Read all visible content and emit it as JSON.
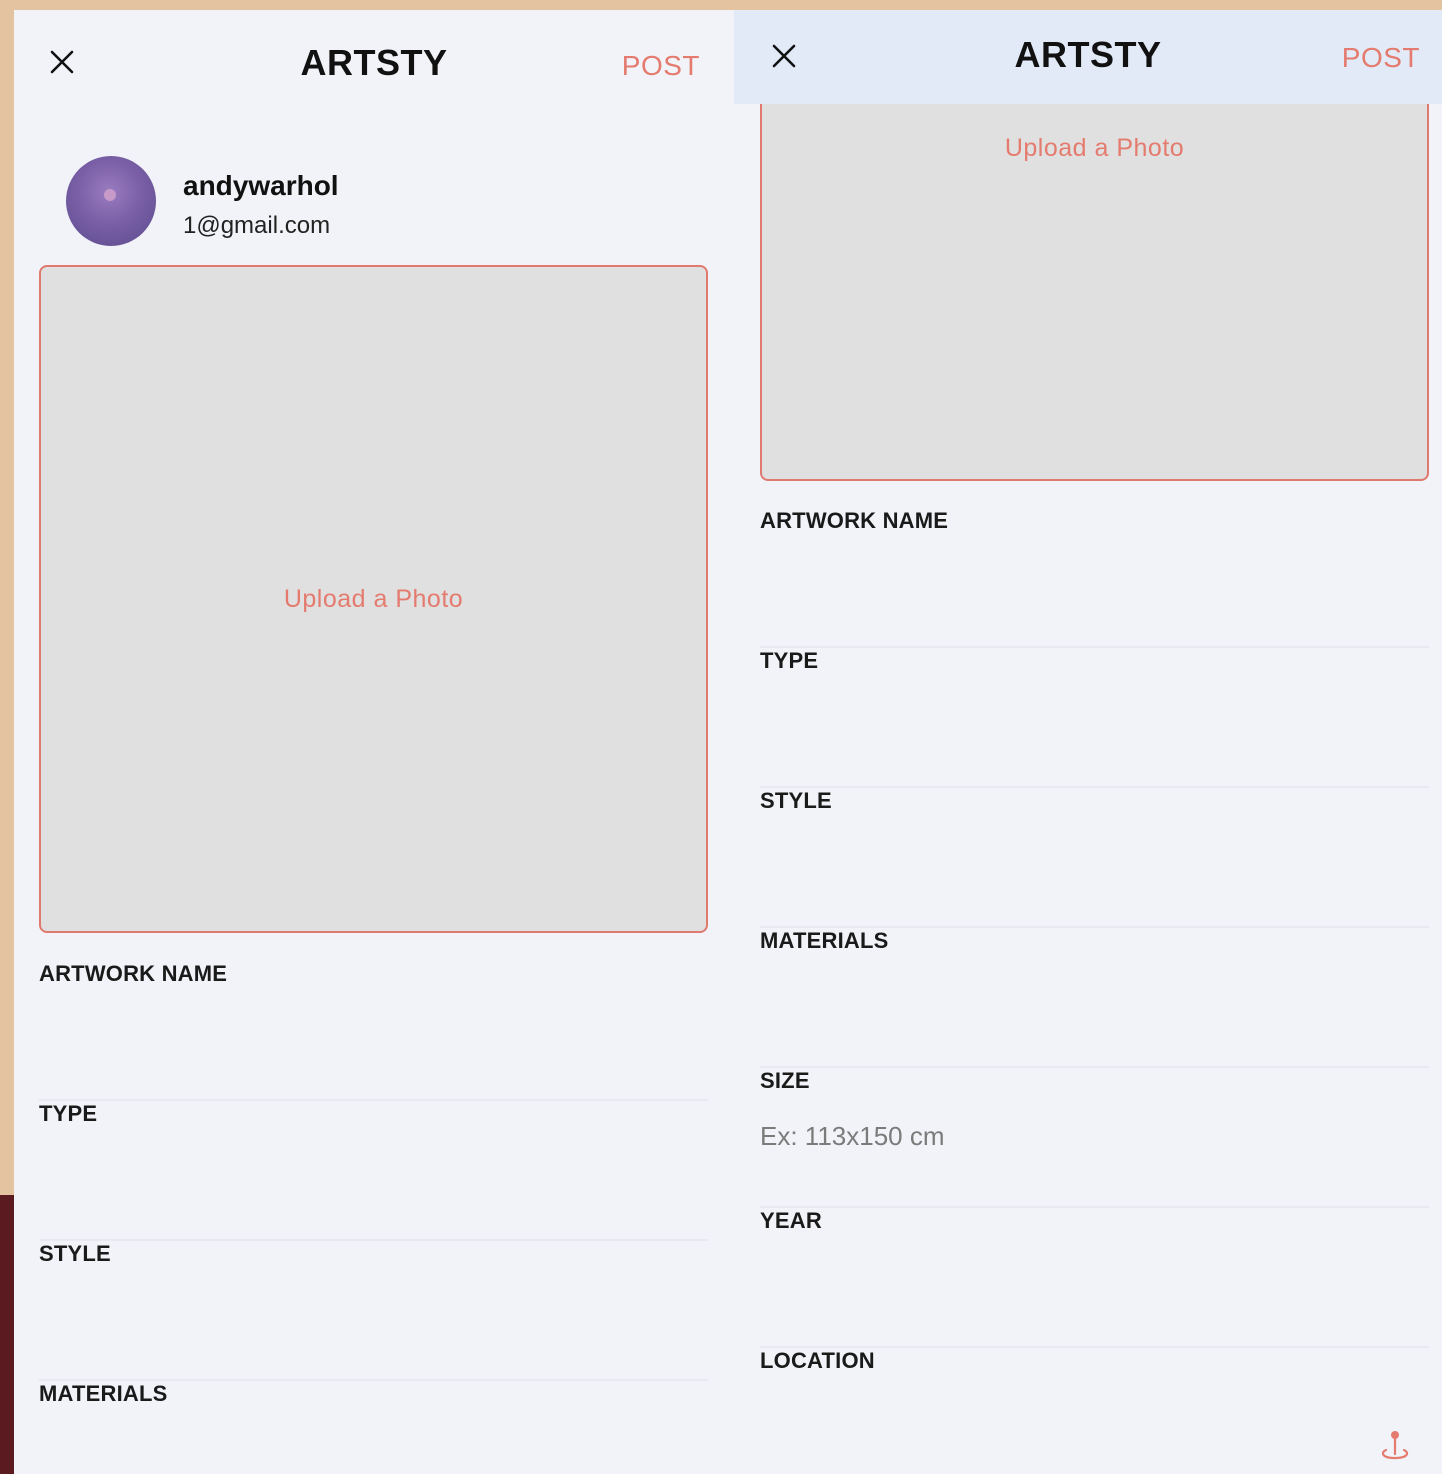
{
  "colors": {
    "accent": "#e47b6e",
    "background": "#f1f3f8",
    "header_right": "#e1eaf6",
    "upload_bg": "#e0e0e0"
  },
  "left_screen": {
    "header": {
      "close_icon": "close-icon",
      "title": "ARTSTY",
      "post_label": "POST"
    },
    "profile": {
      "username": "andywarhol",
      "email": "1@gmail.com"
    },
    "upload": {
      "label": "Upload a Photo"
    },
    "fields": [
      {
        "label": "ARTWORK NAME",
        "value": ""
      },
      {
        "label": "TYPE",
        "value": ""
      },
      {
        "label": "STYLE",
        "value": ""
      },
      {
        "label": "MATERIALS",
        "value": ""
      }
    ]
  },
  "right_screen": {
    "header": {
      "close_icon": "close-icon",
      "title": "ARTSTY",
      "post_label": "POST"
    },
    "upload": {
      "label": "Upload a Photo"
    },
    "fields": [
      {
        "label": "ARTWORK NAME",
        "value": ""
      },
      {
        "label": "TYPE",
        "value": ""
      },
      {
        "label": "STYLE",
        "value": ""
      },
      {
        "label": "MATERIALS",
        "value": ""
      },
      {
        "label": "SIZE",
        "value": "",
        "placeholder": "Ex: 113x150 cm"
      },
      {
        "label": "YEAR",
        "value": ""
      },
      {
        "label": "LOCATION",
        "value": "",
        "icon": "location-pin-icon"
      }
    ]
  }
}
